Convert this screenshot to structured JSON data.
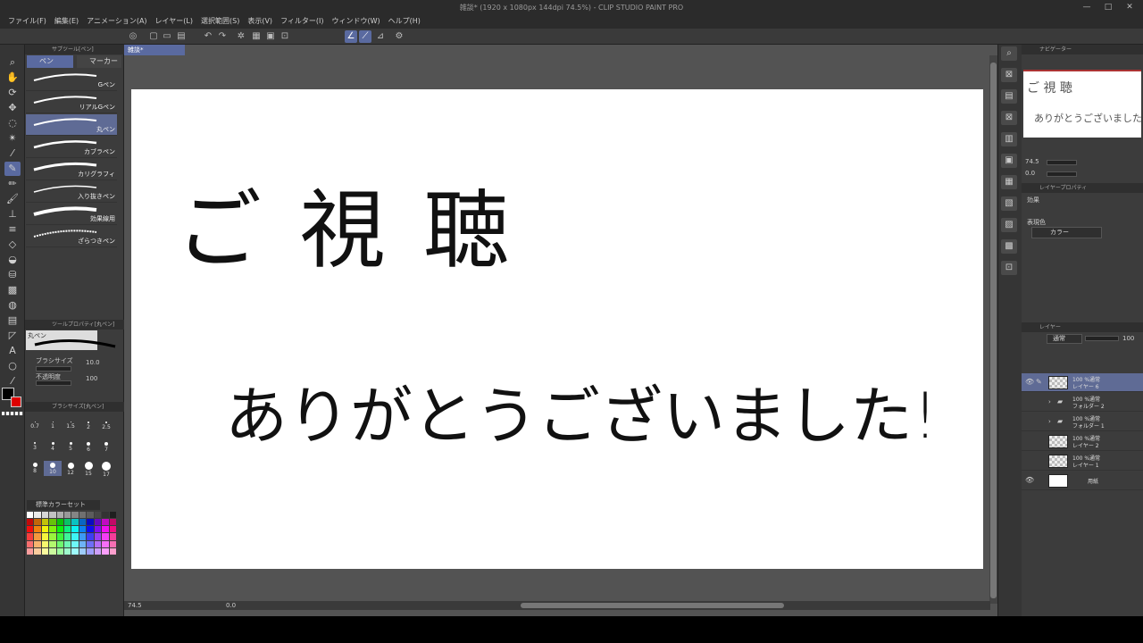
{
  "window": {
    "title": "雑談* (1920 x 1080px 144dpi 74.5%)  - CLIP STUDIO PAINT PRO"
  },
  "menu": [
    "ファイル(F)",
    "編集(E)",
    "アニメーション(A)",
    "レイヤー(L)",
    "選択範囲(S)",
    "表示(V)",
    "フィルター(I)",
    "ウィンドウ(W)",
    "ヘルプ(H)"
  ],
  "document": {
    "tab": "雑談*"
  },
  "subtool": {
    "header": "サブツール[ペン]",
    "tabs": [
      "ペン",
      "マーカー"
    ],
    "brushes": [
      {
        "label": "Gペン",
        "active": false
      },
      {
        "label": "リアルGペン",
        "active": false
      },
      {
        "label": "丸ペン",
        "active": true
      },
      {
        "label": "カブラペン",
        "active": false
      },
      {
        "label": "カリグラフィ",
        "active": false
      },
      {
        "label": "入り抜きペン",
        "active": false
      },
      {
        "label": "効果線用",
        "active": false
      },
      {
        "label": "ざらつきペン",
        "active": false
      }
    ]
  },
  "tool_property": {
    "header": "ツールプロパティ[丸ペン]",
    "preset": "丸ペン",
    "brush_size_label": "ブラシサイズ",
    "brush_size_value": "10.0",
    "opacity_label": "不透明度",
    "opacity_value": "100"
  },
  "brush_size_panel": {
    "header": "ブラシサイズ[丸ペン]",
    "sizes": [
      "0.7",
      "1",
      "1.5",
      "2",
      "2.5",
      "3",
      "4",
      "5",
      "6",
      "7",
      "8",
      "10",
      "12",
      "15",
      "17"
    ],
    "active": "10"
  },
  "color_set": {
    "label": "標準カラーセット"
  },
  "canvas": {
    "line1": "ご 視 聴",
    "line2": "ありがとうございました!",
    "zoom": "74.5",
    "angle": "0.0"
  },
  "navigator": {
    "header": "ナビゲーター",
    "thumb_line1": "ご 視 聴",
    "thumb_line2": "ありがとうございました!",
    "zoom": "74.5",
    "angle": "0.0"
  },
  "layer_property": {
    "header": "レイヤープロパティ",
    "effect_label": "効果",
    "expression_label": "表現色",
    "expression_value": "カラー"
  },
  "layers_panel": {
    "header": "レイヤー",
    "blend": "通常",
    "opacity": "100",
    "layers": [
      {
        "mode": "100 %通常",
        "name": "レイヤー 6",
        "type": "raster",
        "active": true,
        "visible": true
      },
      {
        "mode": "100 %通常",
        "name": "フォルダー 2",
        "type": "folder",
        "active": false,
        "visible": false
      },
      {
        "mode": "100 %通常",
        "name": "フォルダー 1",
        "type": "folder",
        "active": false,
        "visible": false
      },
      {
        "mode": "100 %通常",
        "name": "レイヤー 2",
        "type": "raster",
        "active": false,
        "visible": false
      },
      {
        "mode": "100 %通常",
        "name": "レイヤー 1",
        "type": "raster",
        "active": false,
        "visible": false
      },
      {
        "mode": "",
        "name": "用紙",
        "type": "paper",
        "active": false,
        "visible": true
      }
    ]
  },
  "colors": {
    "accent": "#5a6aa0",
    "panel": "#3c3c3c",
    "canvas_bg": "#535353"
  }
}
